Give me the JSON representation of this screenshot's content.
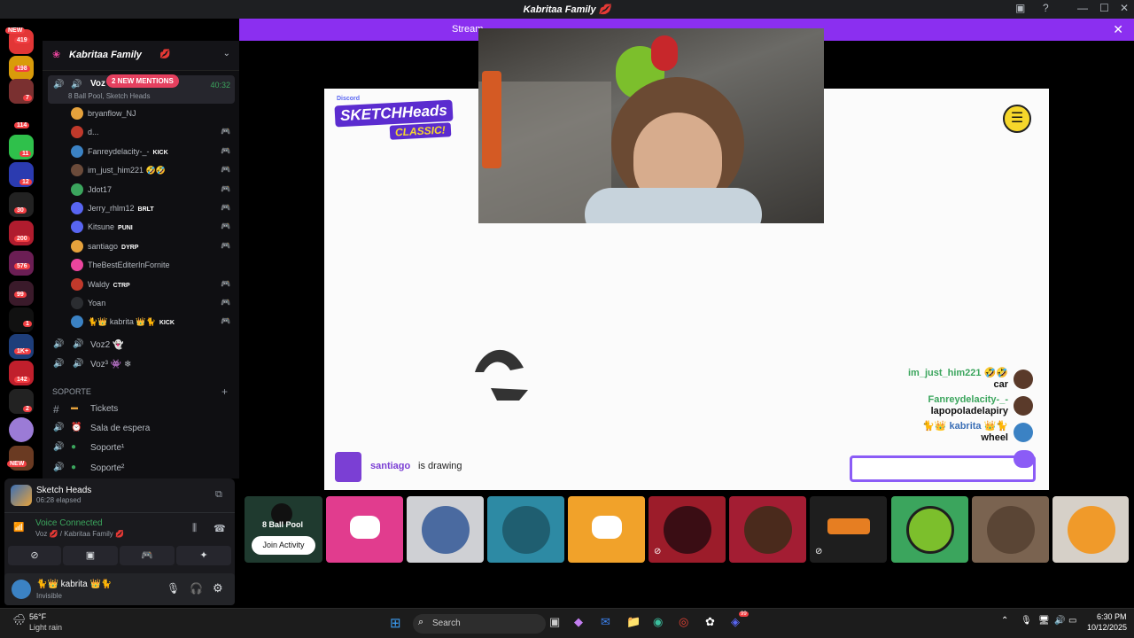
{
  "window": {
    "title": "Kabritaa Family",
    "title_emoji": "💋"
  },
  "banner": {
    "text": "Stream"
  },
  "server_badges": [
    "NEW",
    "419",
    "198",
    "7",
    "114",
    "11",
    "12",
    "30",
    "200",
    "576",
    "99",
    "1",
    "1K+",
    "142",
    "2",
    "NEW"
  ],
  "guild": {
    "name": "Kabritaa Family"
  },
  "voice_active": {
    "name": "Voz",
    "activity": "8 Ball Pool, Sketch Heads",
    "time": "40:32",
    "mentions": "2 NEW MENTIONS"
  },
  "members": [
    {
      "name": "bryanflow_NJ",
      "color": "#e6a23c"
    },
    {
      "name": "d...",
      "color": "#c0392b"
    },
    {
      "name": "Fanreydelacity-_-",
      "tag": "KICK",
      "color": "#3b82c4"
    },
    {
      "name": "im_just_him221 🤣🤣",
      "color": "#6b4b3a"
    },
    {
      "name": "Jdot17",
      "color": "#3ba55d"
    },
    {
      "name": "Jerry_rhlm12",
      "tag": "BRLT",
      "color": "#5865f2"
    },
    {
      "name": "Kitsune",
      "tag": "PUNI",
      "color": "#5865f2"
    },
    {
      "name": "santiago",
      "tag": "DYRP",
      "color": "#e6a23c"
    },
    {
      "name": "TheBestEditerInFornite",
      "color": "#eb459e"
    },
    {
      "name": "Waldy",
      "tag": "CTRP",
      "color": "#c0392b"
    },
    {
      "name": "Yoan",
      "color": "#2b2d31"
    },
    {
      "name": "🐈👑 kabrita 👑🐈",
      "tag": "KICK",
      "color": "#3b82c4"
    }
  ],
  "channels_after": [
    {
      "name": "Voz2 👻"
    },
    {
      "name": "Voz³ 👾 ❄"
    }
  ],
  "category": {
    "name": "SOPORTE"
  },
  "support_channels": [
    {
      "icon": "#",
      "name": "Tickets"
    },
    {
      "icon": "🔊",
      "name": "Sala de espera"
    },
    {
      "icon": "🔊",
      "name": "Soporte¹"
    },
    {
      "icon": "🔊",
      "name": "Soporte²"
    }
  ],
  "activity": {
    "name": "Sketch Heads",
    "elapsed": "06:28 elapsed"
  },
  "voice": {
    "status": "Voice Connected",
    "location": "Voz 💋 / Kabritaa Family 💋"
  },
  "user": {
    "name": "🐈👑 kabrita 👑🐈",
    "status": "Invisible"
  },
  "game": {
    "logo_top": "Discord",
    "logo_main": "SKETCHHeads",
    "logo_sub": "CLASSIC!",
    "drawer": "santiago",
    "drawing_text": "is drawing"
  },
  "chat": [
    {
      "user": "im_just_him221 🤣🤣",
      "text": "car",
      "color": "#3ba55d"
    },
    {
      "user": "Fanreydelacity-_-",
      "text": "lapopoladelapiry",
      "color": "#3ba55d"
    },
    {
      "user": "🐈👑 kabrita 👑🐈",
      "text": "wheel",
      "color": "#3b6fb6"
    }
  ],
  "tile_8ball": {
    "name": "8 Ball Pool",
    "join": "Join Activity"
  },
  "taskbar": {
    "weather_temp": "56°F",
    "weather_desc": "Light rain",
    "search": "Search",
    "time": "6:30 PM",
    "date": "10/12/2025",
    "discord_badge": "99"
  }
}
